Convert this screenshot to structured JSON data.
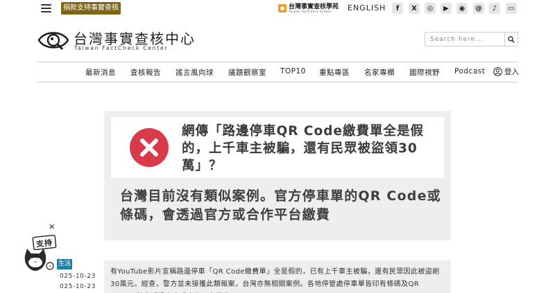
{
  "topbar": {
    "donate_label": "捐款支持事實查核",
    "school_name": "台灣事實查核學苑",
    "school_sub": "Taiwan FactCheck School",
    "language_label": "ENGLISH",
    "social": [
      {
        "icon": "facebook-icon",
        "glyph": "f"
      },
      {
        "icon": "x-twitter-icon",
        "glyph": "X"
      },
      {
        "icon": "instagram-icon",
        "glyph": "◎"
      },
      {
        "icon": "youtube-icon",
        "glyph": "▶"
      },
      {
        "icon": "podcast-icon",
        "glyph": "◉"
      },
      {
        "icon": "threads-icon",
        "glyph": "@"
      },
      {
        "icon": "tiktok-icon",
        "glyph": "♪"
      },
      {
        "icon": "line-icon",
        "glyph": "▭"
      }
    ]
  },
  "header": {
    "title": "台灣事實查核中心",
    "subtitle": "Taiwan FactCheck Center",
    "search_placeholder": "Search here..."
  },
  "nav": {
    "items": [
      "最新消息",
      "查核報告",
      "謠言風向球",
      "議題觀察室",
      "TOP10",
      "重點專區",
      "名家專欄",
      "國際視野",
      "Podcast"
    ],
    "login_label": "登入"
  },
  "verdict": {
    "title": "網傳「路邊停車QR Code繳費單全是假的，上千車主被騙，還有民眾被盜領30萬」？",
    "summary": "台灣目前沒有類似案例。官方停車單的QR Code或條碼，會透過官方或合作平台繳費"
  },
  "meta": {
    "category": "生活",
    "dates": [
      "025-10-23",
      "025-10-23"
    ]
  },
  "article": {
    "text": "有YouTube影片宣稱路邊停車「QR Code繳費單」全是假的，已有上千車主被騙，還有民眾因此被盜刷30萬元。經查，警方並未接獲此類報案，台灣亦無相關案例。各地停管處停車單皆印有條碼及QR Code，將會透過官方或合作平台繳費。"
  },
  "mascot": {
    "sign_text": "支持"
  },
  "colors": {
    "donate_bg": "#7d6518",
    "verdict_red": "#d83a4a",
    "category_blue": "#1f7ea6",
    "card_bg": "#eeeeee"
  }
}
